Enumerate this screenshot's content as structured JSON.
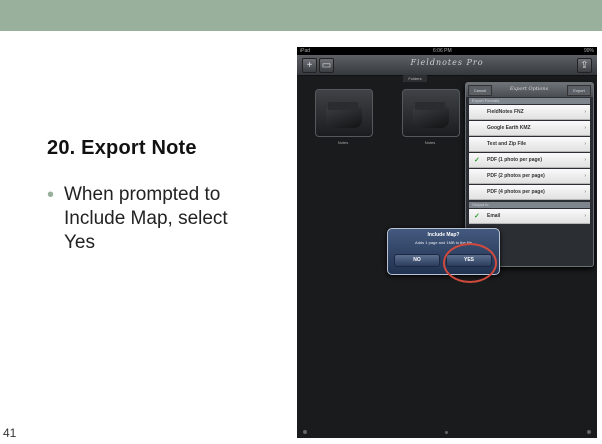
{
  "slide": {
    "title": "20. Export Note",
    "bullet": "When prompted to Include Map, select Yes",
    "page_number": "41"
  },
  "ipad": {
    "status": {
      "left": "iPad",
      "center": "6:06 PM",
      "right": "99%"
    },
    "app_title": "Fieldnotes Pro",
    "folders_tab": "Folders",
    "folders": [
      {
        "label": "Notes"
      },
      {
        "label": "Notes"
      }
    ],
    "popover": {
      "cancel": "Cancel",
      "title": "Export Options",
      "export": "Export",
      "section_formats": "Export Formats",
      "items": [
        {
          "label": "FieldNotes FNZ",
          "checked": false
        },
        {
          "label": "Google Earth KMZ",
          "checked": false
        },
        {
          "label": "Text and Zip File",
          "checked": false
        },
        {
          "label": "PDF (1 photo per page)",
          "checked": true
        },
        {
          "label": "PDF (2 photos per page)",
          "checked": false
        },
        {
          "label": "PDF (4 photos per page)",
          "checked": false
        }
      ],
      "section_output": "Output to",
      "output_item": {
        "label": "Email",
        "checked": true
      }
    },
    "alert": {
      "title": "Include Map?",
      "message": "Adds 1 page and 1MB to the file",
      "no": "NO",
      "yes": "YES"
    }
  },
  "colors": {
    "top_bar": "#99b09c",
    "bullet": "#98b09b",
    "highlight_circle": "#cf4a3d"
  }
}
